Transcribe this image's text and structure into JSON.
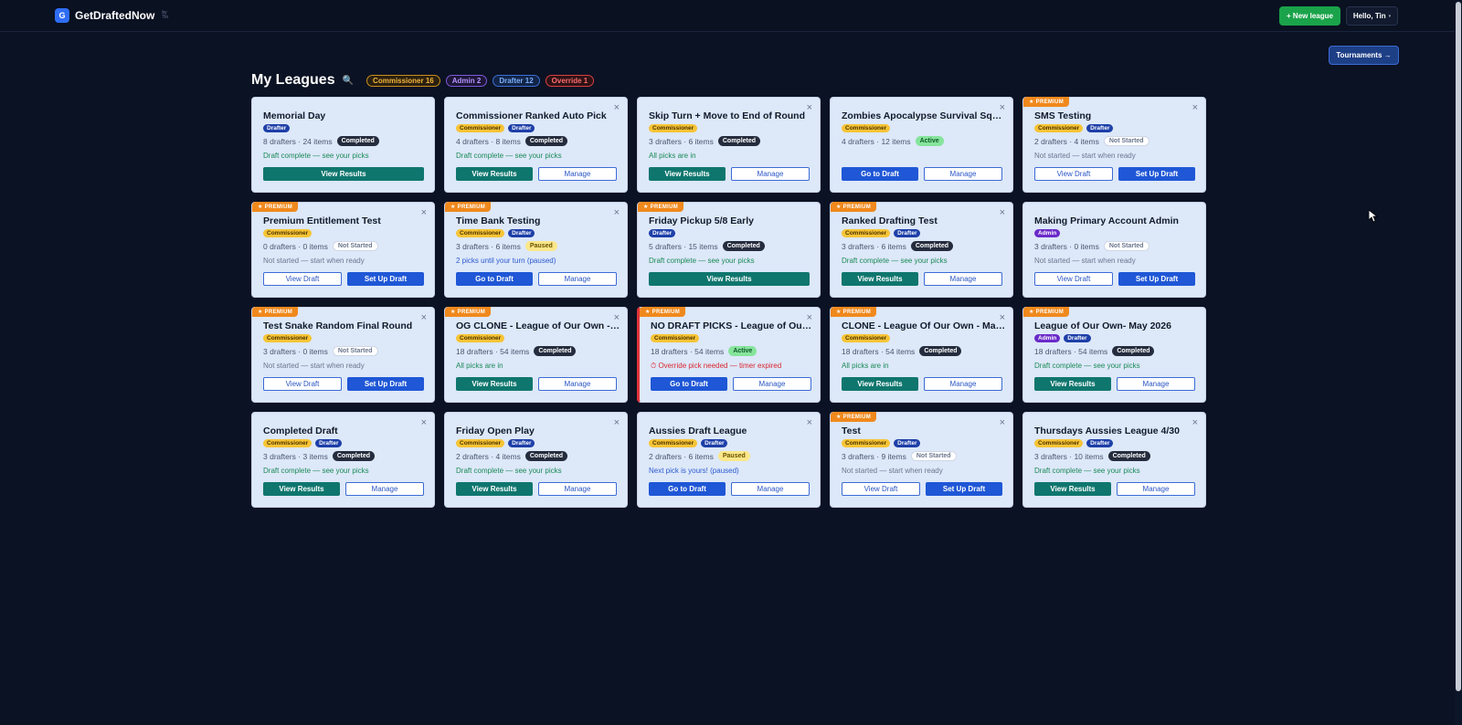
{
  "nav": {
    "logo_letter": "G",
    "brand": "GetDraftedNow",
    "brand_by_1": "by",
    "brand_by_2": "Tin",
    "new_league": "+ New league",
    "hello": "Hello, Tin",
    "caret": "▾"
  },
  "tournaments": "Tournaments →",
  "page_title": "My Leagues",
  "search_icon": "🔍",
  "filters": [
    {
      "label": "Commissioner 16",
      "kind": "comm"
    },
    {
      "label": "Admin 2",
      "kind": "admin"
    },
    {
      "label": "Drafter 12",
      "kind": "drafter"
    },
    {
      "label": "Override 1",
      "kind": "override"
    }
  ],
  "premium_label": "★ PREMIUM",
  "leagues": [
    {
      "title": "Memorial Day",
      "premium": false,
      "closable": false,
      "override": false,
      "roles": [
        "Drafter"
      ],
      "meta": "8 drafters · 24 items",
      "status": "Completed",
      "note": "Draft complete — see your picks",
      "note_color": "green",
      "actions": [
        {
          "label": "View Results",
          "style": "teal"
        }
      ]
    },
    {
      "title": "Commissioner Ranked Auto Pick",
      "premium": false,
      "closable": true,
      "override": false,
      "roles": [
        "Commissioner",
        "Drafter"
      ],
      "meta": "4 drafters · 8 items",
      "status": "Completed",
      "note": "Draft complete — see your picks",
      "note_color": "green",
      "actions": [
        {
          "label": "View Results",
          "style": "teal"
        },
        {
          "label": "Manage",
          "style": "outline"
        }
      ]
    },
    {
      "title": "Skip Turn + Move to End of Round",
      "premium": false,
      "closable": true,
      "override": false,
      "roles": [
        "Commissioner"
      ],
      "meta": "3 drafters · 6 items",
      "status": "Completed",
      "note": "All picks are in",
      "note_color": "green",
      "actions": [
        {
          "label": "View Results",
          "style": "teal"
        },
        {
          "label": "Manage",
          "style": "outline"
        }
      ]
    },
    {
      "title": "Zombies Apocalypse Survival Squa...",
      "premium": false,
      "closable": true,
      "override": false,
      "roles": [
        "Commissioner"
      ],
      "meta": "4 drafters · 12 items",
      "status": "Active",
      "note": "",
      "note_color": "gray",
      "actions": [
        {
          "label": "Go to Draft",
          "style": "blue"
        },
        {
          "label": "Manage",
          "style": "outline"
        }
      ]
    },
    {
      "title": "SMS Testing",
      "premium": true,
      "closable": true,
      "override": false,
      "roles": [
        "Commissioner",
        "Drafter"
      ],
      "meta": "2 drafters · 4 items",
      "status": "Not Started",
      "note": "Not started — start when ready",
      "note_color": "gray",
      "actions": [
        {
          "label": "View Draft",
          "style": "outline"
        },
        {
          "label": "Set Up Draft",
          "style": "blue"
        }
      ]
    },
    {
      "title": "Premium Entitlement Test",
      "premium": true,
      "closable": true,
      "override": false,
      "roles": [
        "Commissioner"
      ],
      "meta": "0 drafters · 0 items",
      "status": "Not Started",
      "note": "Not started — start when ready",
      "note_color": "gray",
      "actions": [
        {
          "label": "View Draft",
          "style": "outline"
        },
        {
          "label": "Set Up Draft",
          "style": "blue"
        }
      ]
    },
    {
      "title": "Time Bank Testing",
      "premium": true,
      "closable": true,
      "override": false,
      "roles": [
        "Commissioner",
        "Drafter"
      ],
      "meta": "3 drafters · 6 items",
      "status": "Paused",
      "note": "2 picks until your turn (paused)",
      "note_color": "blue",
      "actions": [
        {
          "label": "Go to Draft",
          "style": "blue"
        },
        {
          "label": "Manage",
          "style": "outline"
        }
      ]
    },
    {
      "title": "Friday Pickup 5/8 Early",
      "premium": true,
      "closable": false,
      "override": false,
      "roles": [
        "Drafter"
      ],
      "meta": "5 drafters · 15 items",
      "status": "Completed",
      "note": "Draft complete — see your picks",
      "note_color": "green",
      "actions": [
        {
          "label": "View Results",
          "style": "teal"
        }
      ]
    },
    {
      "title": "Ranked Drafting Test",
      "premium": true,
      "closable": true,
      "override": false,
      "roles": [
        "Commissioner",
        "Drafter"
      ],
      "meta": "3 drafters · 6 items",
      "status": "Completed",
      "note": "Draft complete — see your picks",
      "note_color": "green",
      "actions": [
        {
          "label": "View Results",
          "style": "teal"
        },
        {
          "label": "Manage",
          "style": "outline"
        }
      ]
    },
    {
      "title": "Making Primary Account Admin",
      "premium": false,
      "closable": false,
      "override": false,
      "roles": [
        "Admin"
      ],
      "meta": "3 drafters · 0 items",
      "status": "Not Started",
      "note": "Not started — start when ready",
      "note_color": "gray",
      "actions": [
        {
          "label": "View Draft",
          "style": "outline"
        },
        {
          "label": "Set Up Draft",
          "style": "blue"
        }
      ]
    },
    {
      "title": "Test Snake Random Final Round",
      "premium": true,
      "closable": true,
      "override": false,
      "roles": [
        "Commissioner"
      ],
      "meta": "3 drafters · 0 items",
      "status": "Not Started",
      "note": "Not started — start when ready",
      "note_color": "gray",
      "actions": [
        {
          "label": "View Draft",
          "style": "outline"
        },
        {
          "label": "Set Up Draft",
          "style": "blue"
        }
      ]
    },
    {
      "title": "OG CLONE - League of Our Own - M...",
      "premium": true,
      "closable": true,
      "override": false,
      "roles": [
        "Commissioner"
      ],
      "meta": "18 drafters · 54 items",
      "status": "Completed",
      "note": "All picks are in",
      "note_color": "green",
      "actions": [
        {
          "label": "View Results",
          "style": "teal"
        },
        {
          "label": "Manage",
          "style": "outline"
        }
      ]
    },
    {
      "title": "NO DRAFT PICKS - League of Our O...",
      "premium": true,
      "closable": true,
      "override": true,
      "roles": [
        "Commissioner"
      ],
      "meta": "18 drafters · 54 items",
      "status": "Active",
      "note": "⏱ Override pick needed — timer expired",
      "note_color": "red",
      "actions": [
        {
          "label": "Go to Draft",
          "style": "blue"
        },
        {
          "label": "Manage",
          "style": "outline"
        }
      ]
    },
    {
      "title": "CLONE - League Of Our Own - May ...",
      "premium": true,
      "closable": true,
      "override": false,
      "roles": [
        "Commissioner"
      ],
      "meta": "18 drafters · 54 items",
      "status": "Completed",
      "note": "All picks are in",
      "note_color": "green",
      "actions": [
        {
          "label": "View Results",
          "style": "teal"
        },
        {
          "label": "Manage",
          "style": "outline"
        }
      ]
    },
    {
      "title": "League of Our Own- May 2026",
      "premium": true,
      "closable": false,
      "override": false,
      "roles": [
        "Admin",
        "Drafter"
      ],
      "meta": "18 drafters · 54 items",
      "status": "Completed",
      "note": "Draft complete — see your picks",
      "note_color": "green",
      "actions": [
        {
          "label": "View Results",
          "style": "teal"
        },
        {
          "label": "Manage",
          "style": "outline"
        }
      ]
    },
    {
      "title": "Completed Draft",
      "premium": false,
      "closable": true,
      "override": false,
      "roles": [
        "Commissioner",
        "Drafter"
      ],
      "meta": "3 drafters · 3 items",
      "status": "Completed",
      "note": "Draft complete — see your picks",
      "note_color": "green",
      "actions": [
        {
          "label": "View Results",
          "style": "teal"
        },
        {
          "label": "Manage",
          "style": "outline"
        }
      ]
    },
    {
      "title": "Friday Open Play",
      "premium": false,
      "closable": true,
      "override": false,
      "roles": [
        "Commissioner",
        "Drafter"
      ],
      "meta": "2 drafters · 4 items",
      "status": "Completed",
      "note": "Draft complete — see your picks",
      "note_color": "green",
      "actions": [
        {
          "label": "View Results",
          "style": "teal"
        },
        {
          "label": "Manage",
          "style": "outline"
        }
      ]
    },
    {
      "title": "Aussies Draft League",
      "premium": false,
      "closable": true,
      "override": false,
      "roles": [
        "Commissioner",
        "Drafter"
      ],
      "meta": "2 drafters · 6 items",
      "status": "Paused",
      "note": "Next pick is yours! (paused)",
      "note_color": "blue",
      "actions": [
        {
          "label": "Go to Draft",
          "style": "blue"
        },
        {
          "label": "Manage",
          "style": "outline"
        }
      ]
    },
    {
      "title": "Test",
      "premium": true,
      "closable": true,
      "override": false,
      "roles": [
        "Commissioner",
        "Drafter"
      ],
      "meta": "3 drafters · 9 items",
      "status": "Not Started",
      "note": "Not started — start when ready",
      "note_color": "gray",
      "actions": [
        {
          "label": "View Draft",
          "style": "outline"
        },
        {
          "label": "Set Up Draft",
          "style": "blue"
        }
      ]
    },
    {
      "title": "Thursdays Aussies League 4/30",
      "premium": false,
      "closable": true,
      "override": false,
      "roles": [
        "Commissioner",
        "Drafter"
      ],
      "meta": "3 drafters · 10 items",
      "status": "Completed",
      "note": "Draft complete — see your picks",
      "note_color": "green",
      "actions": [
        {
          "label": "View Results",
          "style": "teal"
        },
        {
          "label": "Manage",
          "style": "outline"
        }
      ]
    }
  ]
}
